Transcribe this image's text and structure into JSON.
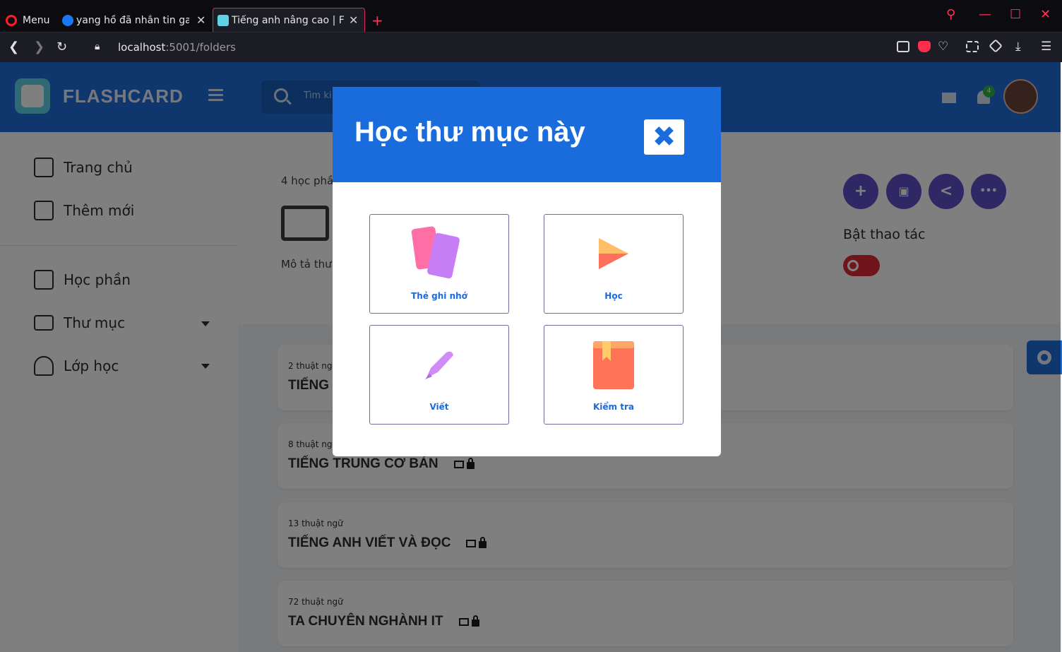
{
  "browser": {
    "menu_label": "Menu",
    "tabs": [
      {
        "label": "yang hồ đã nhắn tin gay"
      },
      {
        "label": "Tiếng anh nâng cao | Flas"
      }
    ],
    "new_tab": "+",
    "url_host": "localhost",
    "url_rest": ":5001/folders"
  },
  "app": {
    "logo_text": "FLASHCARD",
    "search_placeholder": "Tìm ki",
    "notification_count": "4"
  },
  "sidebar": {
    "items": [
      {
        "label": "Trang chủ"
      },
      {
        "label": "Thêm mới"
      },
      {
        "label": "Học phần"
      },
      {
        "label": "Thư mục"
      },
      {
        "label": "Lớp học"
      }
    ]
  },
  "folder": {
    "count_label": "4 học phầ",
    "description_label": "Mô tả thư",
    "toggle_label": "Bật thao tác",
    "actions": [
      "+",
      "▣",
      "<",
      "•••"
    ]
  },
  "cards": [
    {
      "count": "2 thuật ng",
      "title": "TIẾNG"
    },
    {
      "count": "8 thuật ng",
      "title": "TIẾNG TRUNG CƠ BẢN"
    },
    {
      "count": "13 thuật ngữ",
      "title": "TIẾNG ANH VIẾT VÀ ĐỌC"
    },
    {
      "count": "72 thuật ngữ",
      "title": "TA CHUYÊN NGHÀNH IT"
    }
  ],
  "modal": {
    "title": "Học thư mục này",
    "close": "✖",
    "options": [
      {
        "label": "Thẻ ghi nhớ"
      },
      {
        "label": "Học"
      },
      {
        "label": "Viết"
      },
      {
        "label": "Kiểm tra"
      }
    ]
  },
  "colors": {
    "brand_blue": "#1a6bdc",
    "action_purple": "#6051c9",
    "toggle_red": "#e02a38"
  }
}
